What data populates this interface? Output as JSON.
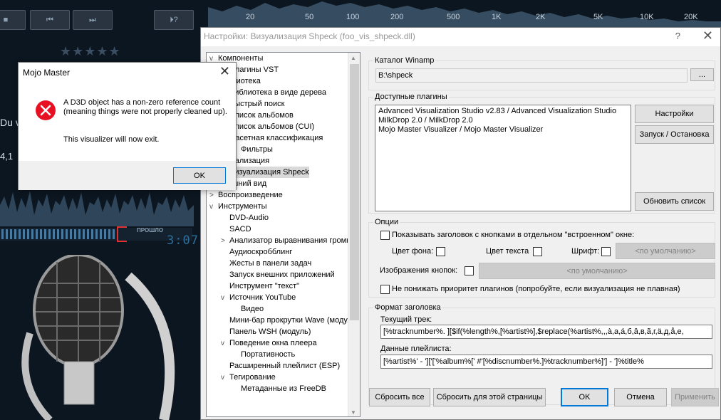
{
  "player": {
    "buttons": [
      "■",
      "⏮",
      "⏭",
      "⏵?"
    ],
    "rating_stars": "★★★★★",
    "side_title": "Du v",
    "side_meta": "4,1",
    "elapsed_label": "ПРОШЛО",
    "elapsed_time": "3:07",
    "spectrum_labels": [
      "20",
      "50",
      "100",
      "200",
      "500",
      "1K",
      "2K",
      "5K",
      "10K",
      "20K"
    ]
  },
  "settings": {
    "title": "Настройки: Визуализация Shpeck (foo_vis_shpeck.dll)",
    "help": "?",
    "close": "✕",
    "tree": [
      {
        "label": "Компоненты",
        "depth": 0,
        "toggle": "v"
      },
      {
        "label": "Плагины VST",
        "depth": 1,
        "toggle": ""
      },
      {
        "label": "Библиотека",
        "depth": 0,
        "toggle": "v"
      },
      {
        "label": "Библиотека в виде дерева",
        "depth": 1,
        "toggle": ""
      },
      {
        "label": "Быстрый поиск",
        "depth": 1,
        "toggle": ""
      },
      {
        "label": "Список альбомов",
        "depth": 1,
        "toggle": ""
      },
      {
        "label": "Список альбомов (CUI)",
        "depth": 1,
        "toggle": ""
      },
      {
        "label": "Фасетная классификация",
        "depth": 1,
        "toggle": "v"
      },
      {
        "label": "Фильтры",
        "depth": 2,
        "toggle": ""
      },
      {
        "label": "Визуализация",
        "depth": 0,
        "toggle": "v"
      },
      {
        "label": "Визуализация Shpeck",
        "depth": 1,
        "toggle": "",
        "selected": true
      },
      {
        "label": "Внешний вид",
        "depth": 0,
        "toggle": ">"
      },
      {
        "label": "Воспроизведение",
        "depth": 0,
        "toggle": ">"
      },
      {
        "label": "Инструменты",
        "depth": 0,
        "toggle": "v"
      },
      {
        "label": "DVD-Audio",
        "depth": 1,
        "toggle": ""
      },
      {
        "label": "SACD",
        "depth": 1,
        "toggle": ""
      },
      {
        "label": "Анализатор выравнивания громкости",
        "depth": 1,
        "toggle": ">"
      },
      {
        "label": "Аудиоскробблинг",
        "depth": 1,
        "toggle": ""
      },
      {
        "label": "Жесты в панели задач",
        "depth": 1,
        "toggle": ""
      },
      {
        "label": "Запуск внешних приложений",
        "depth": 1,
        "toggle": ""
      },
      {
        "label": "Инструмент \"текст\"",
        "depth": 1,
        "toggle": ""
      },
      {
        "label": "Источник YouTube",
        "depth": 1,
        "toggle": "v"
      },
      {
        "label": "Видео",
        "depth": 2,
        "toggle": ""
      },
      {
        "label": "Мини-бар прокрутки Wave (модуль)",
        "depth": 1,
        "toggle": ""
      },
      {
        "label": "Панель WSH (модуль)",
        "depth": 1,
        "toggle": ""
      },
      {
        "label": "Поведение окна плеера",
        "depth": 1,
        "toggle": "v"
      },
      {
        "label": "Портативность",
        "depth": 2,
        "toggle": ""
      },
      {
        "label": "Расширенный плейлист (ESP)",
        "depth": 1,
        "toggle": ""
      },
      {
        "label": "Тегирование",
        "depth": 1,
        "toggle": "v"
      },
      {
        "label": "Метаданные из FreeDB",
        "depth": 2,
        "toggle": ""
      }
    ],
    "winamp_group": "Каталог Winamp",
    "winamp_path": "B:\\shpeck",
    "browse_btn": "...",
    "plugins_group": "Доступные плагины",
    "plugins": [
      "Advanced Visualization Studio v2.83 / Advanced Visualization Studio",
      "MilkDrop 2.0 / MilkDrop 2.0",
      "Mojo Master Visualizer / Mojo Master Visualizer"
    ],
    "btn_config": "Настройки",
    "btn_startstop": "Запуск / Остановка",
    "btn_refresh": "Обновить список",
    "options_group": "Опции",
    "opt_embedded": "Показывать заголовок с кнопками в отдельном \"встроенном\" окне:",
    "bg_color": "Цвет фона:",
    "text_color": "Цвет текста",
    "font": "Шрифт:",
    "default1": "<по умолчанию>",
    "btn_images": "Изображения кнопок:",
    "default2": "<по умолчанию>",
    "opt_priority": "Не понижать приоритет плагинов (попробуйте, если визуализация не плавная)",
    "format_group": "Формат заголовка",
    "current_track": "Текущий трек:",
    "current_track_value": "[%tracknumber%. ][$if(%length%,[%artist%],$replace(%artist%,,,à,a,á,б,â,в,ã,г,ä,д,å,е,",
    "playlist_data": "Данные плейлиста:",
    "playlist_value": "[%artist%' - ']['['%album%[' #'[%discnumber%.]%tracknumber%]'] - ']%title%",
    "btn_reset_all": "Сбросить все",
    "btn_reset_page": "Сбросить для этой страницы",
    "btn_ok": "OK",
    "btn_cancel": "Отмена",
    "btn_apply": "Применить"
  },
  "msgbox": {
    "title": "Mojo Master",
    "close": "✕",
    "message": "A D3D object has a non-zero reference count (meaning things were not properly cleaned up).",
    "message2": "This visualizer will now exit.",
    "ok": "OK",
    "error_color": "#e81123"
  }
}
